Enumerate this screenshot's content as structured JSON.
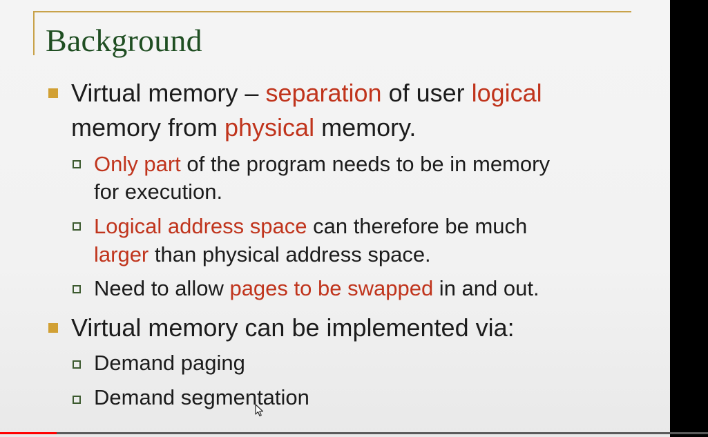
{
  "slide": {
    "title": "Background",
    "bullets": [
      {
        "line1": {
          "a": "Virtual memory – ",
          "b": "separation",
          "c": " of user ",
          "d": "logical"
        },
        "line2": {
          "a": "memory from ",
          "b": "physical",
          "c": " memory."
        },
        "subs": [
          {
            "line1": {
              "a": "Only part",
              "b": " of the program needs to be in memory"
            },
            "line2": "for execution."
          },
          {
            "line1": {
              "a": "Logical address space",
              "b": " can therefore be much"
            },
            "line2": {
              "a": "larger",
              "b": " than physical address space."
            }
          },
          {
            "line1": {
              "a": "Need to allow ",
              "b": "pages to be swapped",
              "c": " in and out."
            }
          }
        ]
      },
      {
        "line1": "Virtual memory can be implemented via:",
        "subs": [
          {
            "line1": "Demand paging"
          },
          {
            "line1": "Demand segmentation"
          }
        ]
      }
    ]
  },
  "colors": {
    "title": "#1f4e22",
    "highlight": "#c0341c",
    "accent_frame": "#c8a24a",
    "bullet_square": "#d1a034"
  },
  "video": {
    "progress_fraction": 0.08
  }
}
